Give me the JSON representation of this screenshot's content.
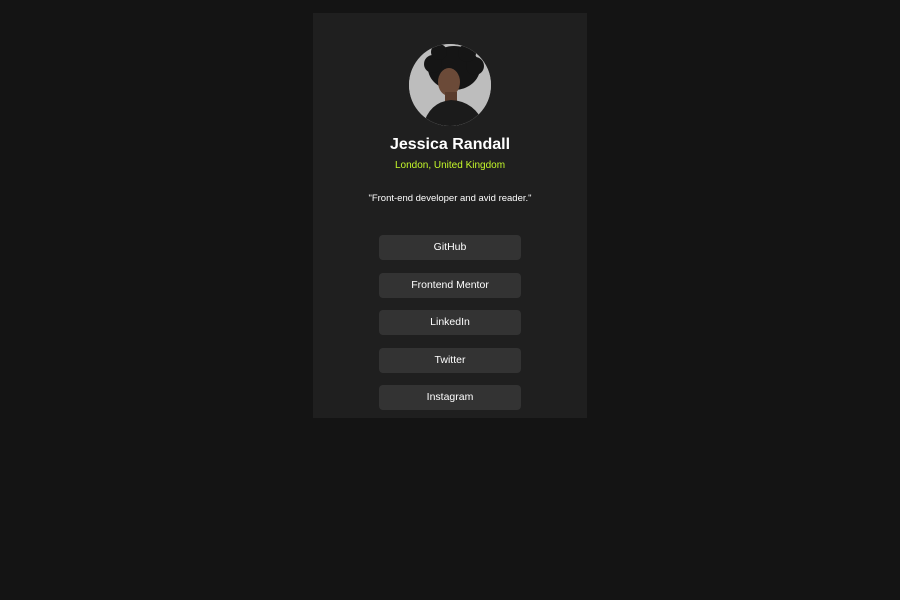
{
  "profile": {
    "name": "Jessica Randall",
    "location": "London, United Kingdom",
    "bio": "\"Front-end developer and avid reader.\""
  },
  "links": [
    {
      "label": "GitHub"
    },
    {
      "label": "Frontend Mentor"
    },
    {
      "label": "LinkedIn"
    },
    {
      "label": "Twitter"
    },
    {
      "label": "Instagram"
    }
  ],
  "colors": {
    "page_background": "#141414",
    "card_background": "#1f1f1f",
    "button_background": "#333333",
    "accent": "#c4f82a",
    "text": "#ffffff"
  }
}
